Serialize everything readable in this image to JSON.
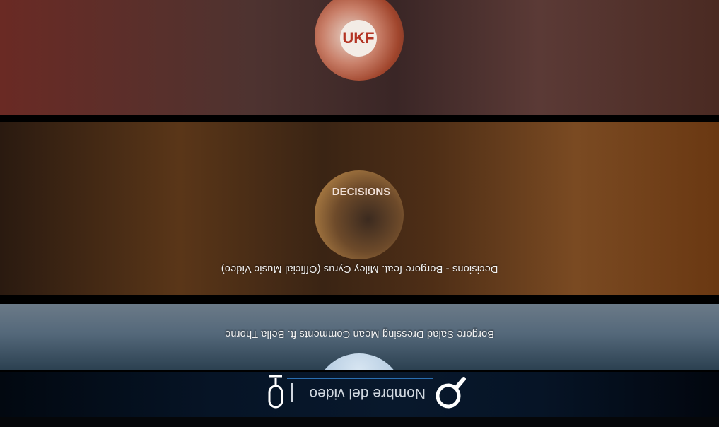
{
  "search": {
    "placeholder": "Nombre del video",
    "value": ""
  },
  "icons": {
    "search": "search-icon",
    "microphone": "microphone-icon"
  },
  "videos": [
    {
      "title": "Borgore Salad Dressing Mean Comments ft. Bella Thorne"
    },
    {
      "title": "Decisions - Borgore feat. Miley Cyrus (Official Music Video)",
      "thumb_text": "DECISIONS"
    },
    {
      "title": "",
      "thumb_text": "UKF"
    }
  ],
  "colors": {
    "accent": "#2a6eb0",
    "header_bg": "#061426",
    "text": "#f2f2f2"
  }
}
